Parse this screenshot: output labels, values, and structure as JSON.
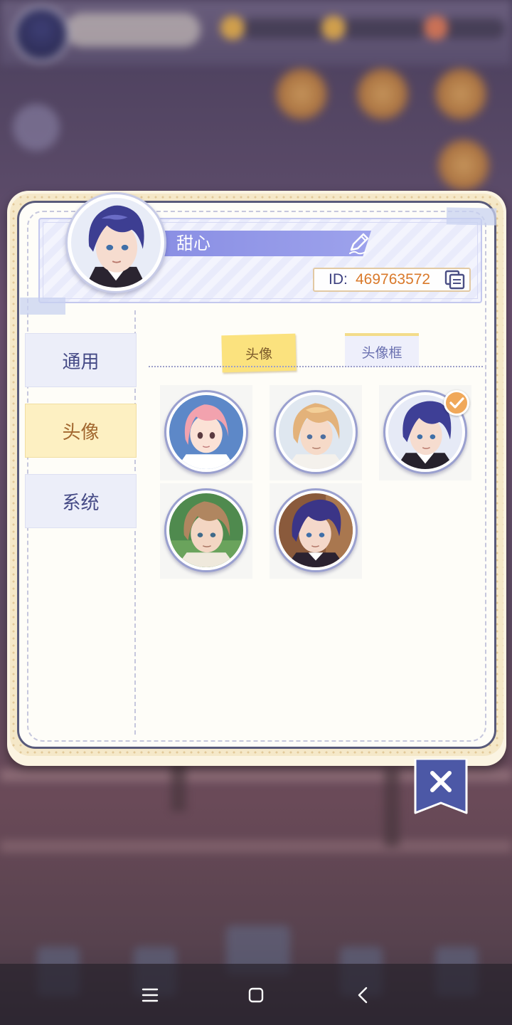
{
  "profile": {
    "name": "甜心",
    "id_label": "ID:",
    "id_value": "469763572"
  },
  "side_nav": {
    "items": [
      {
        "label": "通用",
        "active": false
      },
      {
        "label": "头像",
        "active": true
      },
      {
        "label": "系统",
        "active": false
      }
    ]
  },
  "content_tabs": [
    {
      "label": "头像",
      "active": true
    },
    {
      "label": "头像框",
      "active": false
    }
  ],
  "avatars": [
    {
      "name": "pink-hair-girl-avatar",
      "selected": false
    },
    {
      "name": "blond-boy-avatar",
      "selected": false
    },
    {
      "name": "purple-hair-boy-avatar",
      "selected": true
    },
    {
      "name": "brown-hair-boy-avatar",
      "selected": false
    },
    {
      "name": "dark-purple-hair-boy-avatar",
      "selected": false
    }
  ],
  "colors": {
    "accent_purple": "#8a8fe4",
    "active_tab_yellow": "#fbe27e",
    "id_orange": "#d9792a",
    "nav_text": "#454a86",
    "close_flag": "#4c58a6"
  },
  "icons": {
    "edit": "pencil-icon",
    "copy": "copy-icon",
    "close": "close-icon",
    "check": "check-icon",
    "nav": [
      "menu-icon",
      "home-icon",
      "back-icon"
    ]
  }
}
